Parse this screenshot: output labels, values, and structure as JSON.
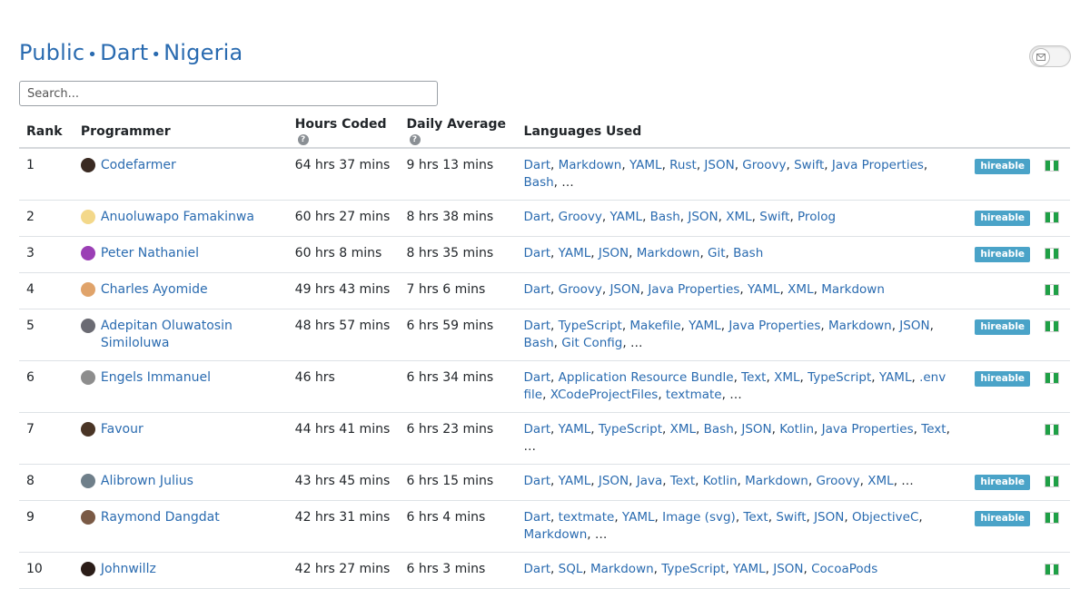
{
  "title": {
    "part1": "Public",
    "sep": "•",
    "part2": "Dart",
    "part3": "Nigeria"
  },
  "search": {
    "placeholder": "Search..."
  },
  "columns": {
    "rank": "Rank",
    "programmer": "Programmer",
    "hours": "Hours Coded",
    "daily": "Daily Average",
    "languages": "Languages Used",
    "help_glyph": "?"
  },
  "colors": {
    "link": "#2a6bb0",
    "badge": "#4aa3c8",
    "flag_green": "#1fa046"
  },
  "rows": [
    {
      "rank": "1",
      "name": "Codefarmer",
      "avatar": "#3a2a22",
      "hours": "64 hrs 37 mins",
      "daily": "9 hrs 13 mins",
      "langs": [
        "Dart",
        "Markdown",
        "YAML",
        "Rust",
        "JSON",
        "Groovy",
        "Swift",
        "Java Properties",
        "Bash"
      ],
      "more": "…",
      "hireable": "hireable"
    },
    {
      "rank": "2",
      "name": "Anuoluwapo Famakinwa",
      "avatar": "#f3d88a",
      "hours": "60 hrs 27 mins",
      "daily": "8 hrs 38 mins",
      "langs": [
        "Dart",
        "Groovy",
        "YAML",
        "Bash",
        "JSON",
        "XML",
        "Swift",
        "Prolog"
      ],
      "more": "",
      "hireable": "hireable"
    },
    {
      "rank": "3",
      "name": "Peter Nathaniel",
      "avatar": "#9b3fb5",
      "hours": "60 hrs 8 mins",
      "daily": "8 hrs 35 mins",
      "langs": [
        "Dart",
        "YAML",
        "JSON",
        "Markdown",
        "Git",
        "Bash"
      ],
      "more": "",
      "hireable": "hireable"
    },
    {
      "rank": "4",
      "name": "Charles Ayomide",
      "avatar": "#e0a36a",
      "hours": "49 hrs 43 mins",
      "daily": "7 hrs 6 mins",
      "langs": [
        "Dart",
        "Groovy",
        "JSON",
        "Java Properties",
        "YAML",
        "XML",
        "Markdown"
      ],
      "more": "",
      "hireable": ""
    },
    {
      "rank": "5",
      "name": "Adepitan Oluwatosin Similoluwa",
      "avatar": "#6b6b73",
      "hours": "48 hrs 57 mins",
      "daily": "6 hrs 59 mins",
      "langs": [
        "Dart",
        "TypeScript",
        "Makefile",
        "YAML",
        "Java Properties",
        "Markdown",
        "JSON",
        "Bash",
        "Git Config"
      ],
      "more": "…",
      "hireable": "hireable"
    },
    {
      "rank": "6",
      "name": "Engels Immanuel",
      "avatar": "#8d8d8d",
      "hours": "46 hrs",
      "daily": "6 hrs 34 mins",
      "langs": [
        "Dart",
        "Application Resource Bundle",
        "Text",
        "XML",
        "TypeScript",
        "YAML",
        ".env file",
        "XCodeProjectFiles",
        "textmate"
      ],
      "more": "…",
      "hireable": "hireable"
    },
    {
      "rank": "7",
      "name": "Favour",
      "avatar": "#4a3526",
      "hours": "44 hrs 41 mins",
      "daily": "6 hrs 23 mins",
      "langs": [
        "Dart",
        "YAML",
        "TypeScript",
        "XML",
        "Bash",
        "JSON",
        "Kotlin",
        "Java Properties",
        "Text"
      ],
      "more": "…",
      "hireable": ""
    },
    {
      "rank": "8",
      "name": "Alibrown Julius",
      "avatar": "#6f7f8a",
      "hours": "43 hrs 45 mins",
      "daily": "6 hrs 15 mins",
      "langs": [
        "Dart",
        "YAML",
        "JSON",
        "Java",
        "Text",
        "Kotlin",
        "Markdown",
        "Groovy",
        "XML"
      ],
      "more": "…",
      "hireable": "hireable"
    },
    {
      "rank": "9",
      "name": "Raymond Dangdat",
      "avatar": "#7a5a45",
      "hours": "42 hrs 31 mins",
      "daily": "6 hrs 4 mins",
      "langs": [
        "Dart",
        "textmate",
        "YAML",
        "Image (svg)",
        "Text",
        "Swift",
        "JSON",
        "ObjectiveC",
        "Markdown"
      ],
      "more": "…",
      "hireable": "hireable"
    },
    {
      "rank": "10",
      "name": "Johnwillz",
      "avatar": "#2b1d18",
      "hours": "42 hrs 27 mins",
      "daily": "6 hrs 3 mins",
      "langs": [
        "Dart",
        "SQL",
        "Markdown",
        "TypeScript",
        "YAML",
        "JSON",
        "CocoaPods"
      ],
      "more": "",
      "hireable": ""
    }
  ]
}
